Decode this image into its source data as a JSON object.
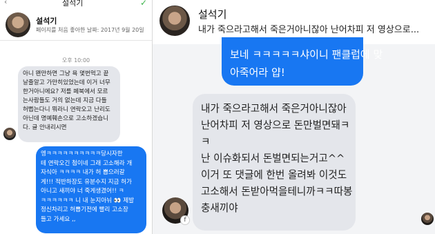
{
  "left": {
    "header_title": "설석기",
    "back_label": "‹",
    "confirm_icon": "check-icon",
    "profile": {
      "name": "설석기",
      "meta": "페이지를 처음 좋아한 날짜: 2017년 9월 20일"
    },
    "timestamp": "오후 10:00",
    "messages": [
      {
        "from": "other",
        "lines": [
          "아니 왠만하면 그냥 욕 몇번먹고 끝",
          "날줄알고 가만히있었는데 이거 너무",
          "한거아니에요? 저를 페북에서 모르",
          "는사람들도 거의 없는데 지금 다들",
          "허뻡는다니 뭐라니 연락오고 난리도",
          "아닌데 명예훼손으로 고소하겠습니",
          "다. 글 안내리시면"
        ]
      },
      {
        "from": "me",
        "lines": [
          "엥ㅋㅋㅋㅋㅋㅋㅋㅋㅋㅋ당시자한",
          "테 연락오긴 첨이네 그래 고소해라 개",
          "자식아 ㅋㅋㅋㅋ 내가 허 뽑으러갈",
          "게!!! 적반하장도 유분수지 지금 허가",
          "아니고 새끼야 너 죽게생겼어!! ㅋ",
          "ㅋㅋㅋㅋㅋㅋ 니 내 눈지아뉘 👀 제발",
          "정신차리고 허뽑기전에 빨리 고소장",
          "들고 가세요 ,,"
        ]
      }
    ]
  },
  "right": {
    "contact_name": "설석기",
    "preview": "내가 죽으라고해서 죽은거아니잖아 난어차피 저 영상으로...",
    "messages": [
      {
        "from": "me",
        "lines": [
          "보네 ㅋㅋㅋㅋㅋ샤이니 팬클럽에 맞",
          "아죽어라 얍!"
        ]
      },
      {
        "from": "other",
        "lines": [
          "내가 죽으라고해서 죽은거아니잖아",
          "난어차피 저 영상으로 돈만벌면돼ㅋ",
          "ㅋ",
          "난 이슈화되서 돈벌면되는거고^^",
          "이거 또 댓글에 한번 올려봐 이것도",
          "고소해서 돈받아먹을테니까ㅋㅋ따봉",
          "충새끼야"
        ]
      }
    ],
    "badge_label": "f"
  },
  "colors": {
    "sent_bubble": "#1877f2",
    "received_bubble": "#e4e6eb",
    "confirm": "#3cb34a"
  }
}
